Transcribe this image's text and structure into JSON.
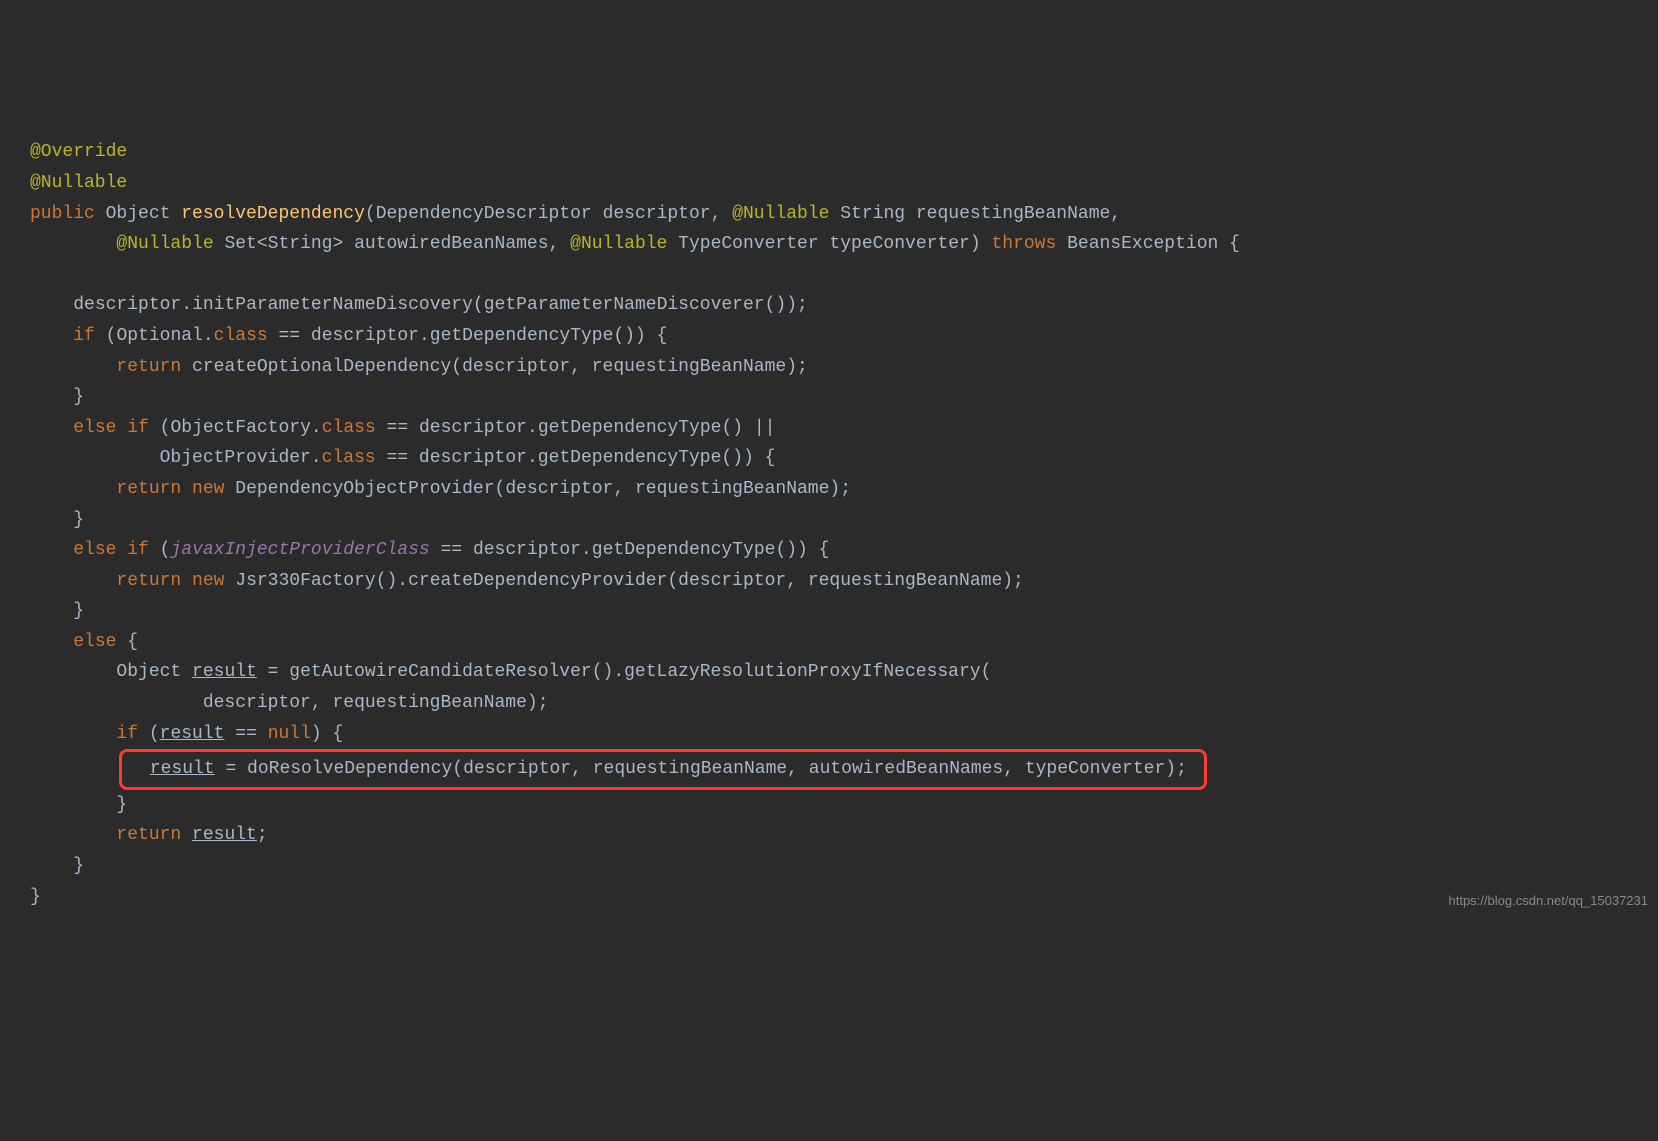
{
  "tokens": {
    "override": "@Override",
    "nullable": "@Nullable",
    "public": "public",
    "object": "Object",
    "resolveDependency": "resolveDependency",
    "dependencyDescriptor": "DependencyDescriptor",
    "descriptor": "descriptor",
    "string": "String",
    "requestingBeanName": "requestingBeanName",
    "set": "Set",
    "autowiredBeanNames": "autowiredBeanNames",
    "typeConverter": "TypeConverter",
    "typeConverterParam": "typeConverter",
    "throws": "throws",
    "beansException": "BeansException",
    "initParam": "initParameterNameDiscovery",
    "getParamName": "getParameterNameDiscoverer",
    "if": "if",
    "optional": "Optional",
    "class": "class",
    "eq": "==",
    "getDepType": "getDependencyType",
    "return": "return",
    "createOptDep": "createOptionalDependency",
    "else": "else",
    "objectFactory": "ObjectFactory",
    "or": "||",
    "objectProvider": "ObjectProvider",
    "new": "new",
    "depObjProvider": "DependencyObjectProvider",
    "javaxInject": "javaxInjectProviderClass",
    "jsr330": "Jsr330Factory",
    "createDepProvider": "createDependencyProvider",
    "result": "result",
    "getAutowire": "getAutowireCandidateResolver",
    "getLazy": "getLazyResolutionProxyIfNecessary",
    "null": "null",
    "doResolve": "doResolveDependency"
  },
  "watermark": "https://blog.csdn.net/qq_15037231"
}
